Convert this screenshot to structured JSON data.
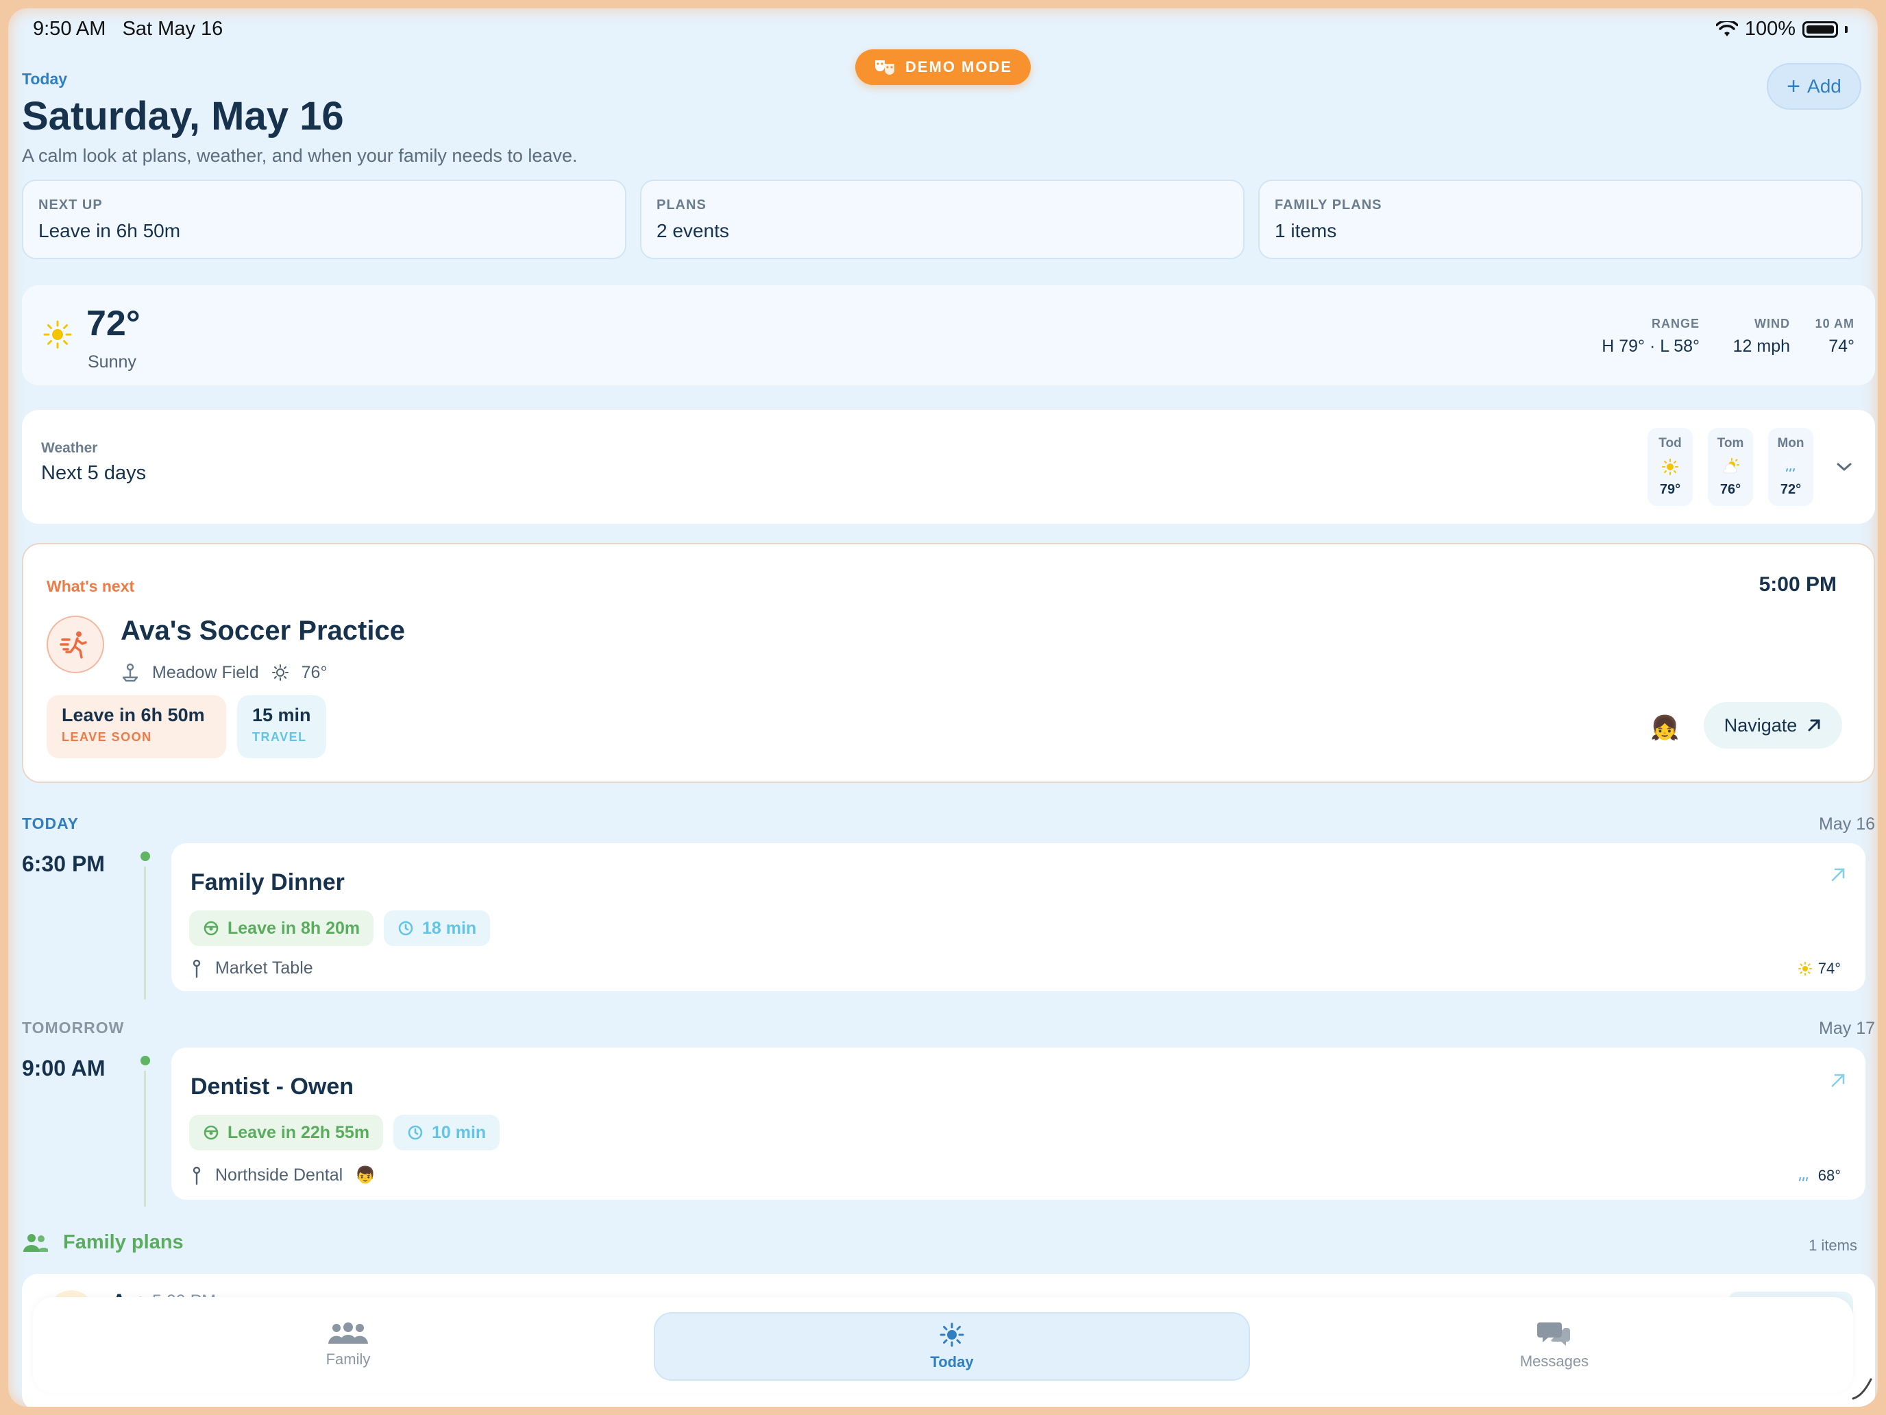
{
  "status": {
    "time": "9:50 AM",
    "date": "Sat May 16",
    "battery": "100%"
  },
  "demo_badge": "DEMO MODE",
  "header": {
    "tag": "Today",
    "title": "Saturday, May 16",
    "subtitle": "A calm look at plans, weather, and when your family needs to leave.",
    "add_label": "Add"
  },
  "summary": [
    {
      "label": "NEXT UP",
      "value": "Leave in 6h 50m"
    },
    {
      "label": "PLANS",
      "value": "2 events"
    },
    {
      "label": "FAMILY PLANS",
      "value": "1 items"
    }
  ],
  "weather_now": {
    "temp": "72°",
    "condition": "Sunny",
    "stats": [
      {
        "label": "RANGE",
        "value": "H 79° · L 58°"
      },
      {
        "label": "WIND",
        "value": "12 mph"
      },
      {
        "label": "10 AM",
        "value": "74°"
      }
    ]
  },
  "forecast": {
    "label": "Weather",
    "title": "Next 5 days",
    "days": [
      {
        "day": "Tod",
        "temp": "79°",
        "icon": "sun-icon"
      },
      {
        "day": "Tom",
        "temp": "76°",
        "icon": "partly-sunny-icon"
      },
      {
        "day": "Mon",
        "temp": "72°",
        "icon": "drizzle-icon"
      }
    ]
  },
  "whats_next": {
    "tag": "What's next",
    "time": "5:00 PM",
    "title": "Ava's Soccer Practice",
    "location": "Meadow Field",
    "temp": "76°",
    "leave": {
      "value": "Leave in 6h 50m",
      "label": "LEAVE SOON"
    },
    "travel": {
      "value": "15 min",
      "label": "TRAVEL"
    },
    "avatar": "👧",
    "navigate_label": "Navigate"
  },
  "today": {
    "tag": "TODAY",
    "date": "May 16",
    "event": {
      "time": "6:30 PM",
      "title": "Family Dinner",
      "leave": "Leave in 8h 20m",
      "travel": "18 min",
      "location": "Market Table",
      "temp": "74°"
    }
  },
  "tomorrow": {
    "tag": "TOMORROW",
    "date": "May 17",
    "event": {
      "time": "9:00 AM",
      "title": "Dentist - Owen",
      "leave": "Leave in 22h 55m",
      "travel": "10 min",
      "location": "Northside Dental",
      "avatar": "👦",
      "temp": "68°"
    }
  },
  "family_plans": {
    "title": "Family plans",
    "count": "1 items",
    "peek": {
      "name": "Ava",
      "time": "5:00 PM"
    }
  },
  "tabs": [
    {
      "label": "Family",
      "icon": "family-icon"
    },
    {
      "label": "Today",
      "icon": "sun-icon"
    },
    {
      "label": "Messages",
      "icon": "messages-icon"
    }
  ],
  "colors": {
    "accent": "#2f7fc1",
    "orange": "#f7922f",
    "green": "#5aad5e",
    "cyan": "#64c4e3",
    "text": "#17324d"
  }
}
